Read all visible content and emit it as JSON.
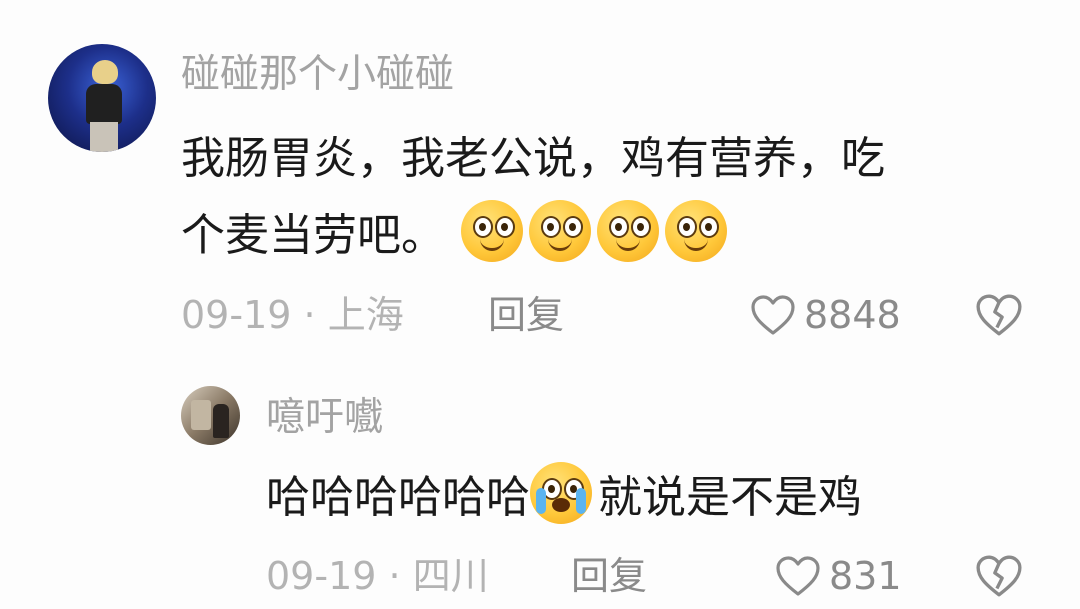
{
  "comments": [
    {
      "username": "碰碰那个小碰碰",
      "text_line1": "我肠胃炎，我老公说，鸡有营养，吃",
      "text_line2": "个麦当劳吧。",
      "emoji_icon": "smiling-face-emoji",
      "emoji_count": 4,
      "date": "09-19",
      "separator": "·",
      "location": "上海",
      "reply_label": "回复",
      "like_count": "8848"
    },
    {
      "username": "噫吁嚱",
      "text_before_emoji": "哈哈哈哈哈哈",
      "emoji_icon": "crying-laughing-emoji",
      "text_after_emoji": "就说是不是鸡",
      "date": "09-19",
      "separator": "·",
      "location": "四川",
      "reply_label": "回复",
      "like_count": "831"
    }
  ],
  "colors": {
    "username": "#a3a3a3",
    "text": "#1a1a1a",
    "meta": "#b3b3b3",
    "action": "#8a8a8a",
    "background": "#fdfdfd"
  }
}
